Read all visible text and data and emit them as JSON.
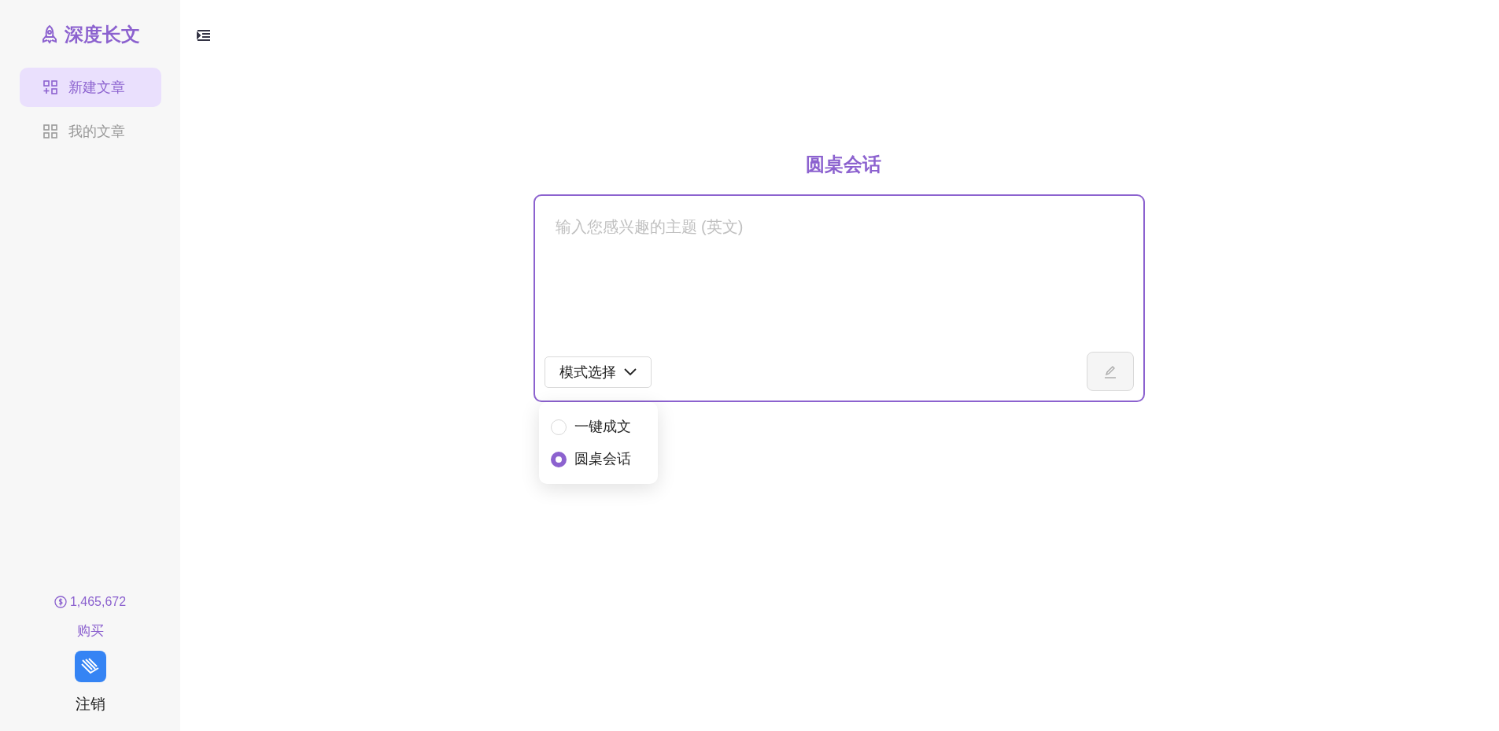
{
  "sidebar": {
    "logo": "深度长文",
    "items": [
      {
        "label": "新建文章",
        "selected": true
      },
      {
        "label": "我的文章",
        "selected": false
      }
    ],
    "balance": "1,465,672",
    "buy": "购买",
    "logout": "注销"
  },
  "main": {
    "title": "圆桌会话",
    "input": {
      "placeholder": "输入您感兴趣的主题 (英文)"
    },
    "mode_button": "模式选择",
    "mode_menu": [
      {
        "label": "一键成文",
        "selected": false
      },
      {
        "label": "圆桌会话",
        "selected": true
      }
    ]
  }
}
